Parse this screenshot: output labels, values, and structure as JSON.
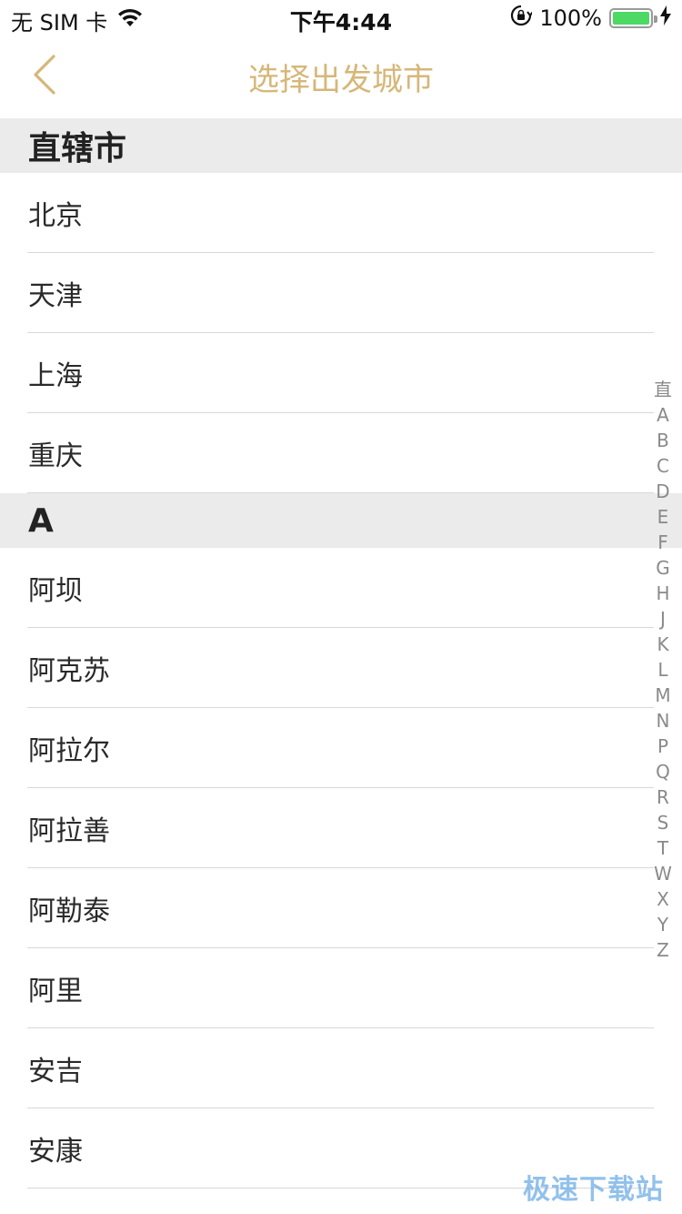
{
  "status_bar": {
    "carrier": "无 SIM 卡",
    "time": "下午4:44",
    "battery_percent": "100%",
    "battery_level": 1.0
  },
  "nav": {
    "title": "选择出发城市",
    "accent_color": "#d6b779"
  },
  "sections": [
    {
      "header": "直辖市",
      "cities": [
        "北京",
        "天津",
        "上海",
        "重庆"
      ]
    },
    {
      "header": "A",
      "cities": [
        "阿坝",
        "阿克苏",
        "阿拉尔",
        "阿拉善",
        "阿勒泰",
        "阿里",
        "安吉",
        "安康"
      ]
    }
  ],
  "index_letters": [
    "直",
    "A",
    "B",
    "C",
    "D",
    "E",
    "F",
    "G",
    "H",
    "J",
    "K",
    "L",
    "M",
    "N",
    "P",
    "Q",
    "R",
    "S",
    "T",
    "W",
    "X",
    "Y",
    "Z"
  ],
  "watermark": "极速下载站"
}
